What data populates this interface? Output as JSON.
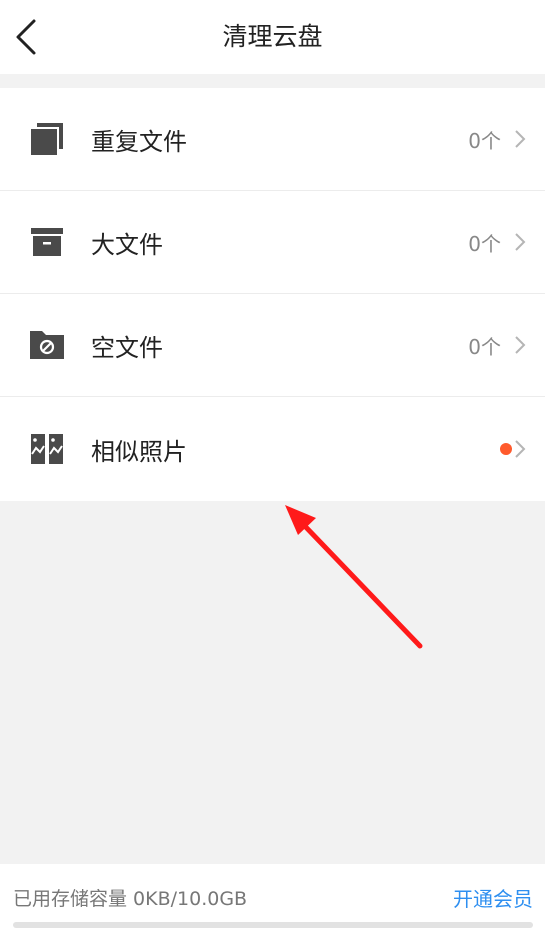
{
  "header": {
    "title": "清理云盘",
    "back_icon": "chevron-left-icon"
  },
  "items": [
    {
      "label": "重复文件",
      "count": "0个",
      "icon": "duplicate-files-icon"
    },
    {
      "label": "大文件",
      "count": "0个",
      "icon": "archive-box-icon"
    },
    {
      "label": "空文件",
      "count": "0个",
      "icon": "empty-folder-icon"
    },
    {
      "label": "相似照片",
      "icon": "similar-photos-icon",
      "badge": "red-dot"
    }
  ],
  "footer": {
    "storage_text": "已用存储容量 0KB/10.0GB",
    "vip_label": "开通会员",
    "storage_used_fraction": 0
  },
  "colors": {
    "accent": "#2e8ff0",
    "badge": "#ff5a2c",
    "icon": "#4a4a4a",
    "annotation_arrow": "#ff1a1a"
  }
}
